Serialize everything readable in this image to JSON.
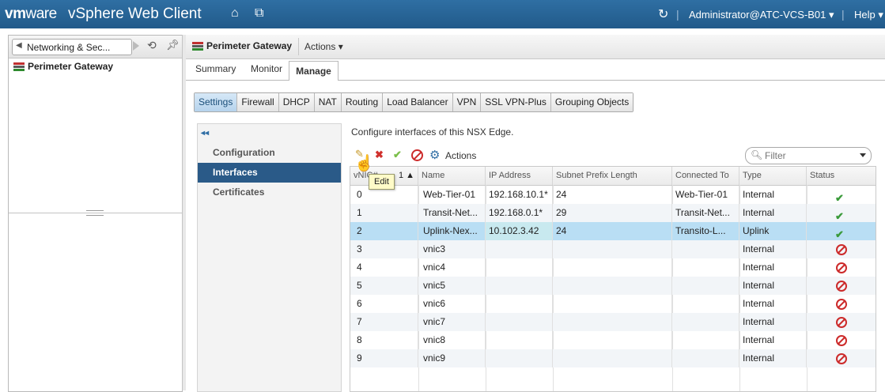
{
  "app": {
    "logo_vm": "vm",
    "logo_ware": "ware",
    "title": "vSphere Web Client",
    "user": "Administrator@ATC-VCS-B01",
    "help": "Help"
  },
  "left": {
    "nav_label": "Networking & Sec...",
    "tree_item": "Perimeter Gateway"
  },
  "main": {
    "title": "Perimeter Gateway",
    "actions": "Actions",
    "tabs": [
      "Summary",
      "Monitor",
      "Manage"
    ],
    "subtabs": [
      "Settings",
      "Firewall",
      "DHCP",
      "NAT",
      "Routing",
      "Load Balancer",
      "VPN",
      "SSL VPN-Plus",
      "Grouping Objects"
    ],
    "inner_nav": [
      "Configuration",
      "Interfaces",
      "Certificates"
    ],
    "description": "Configure interfaces of this NSX Edge.",
    "toolbar_actions": "Actions",
    "tooltip": "Edit",
    "filter_placeholder": "Filter"
  },
  "grid": {
    "columns": [
      "vNIC#",
      "Name",
      "IP Address",
      "Subnet Prefix Length",
      "Connected To",
      "Type",
      "Status"
    ],
    "sort_indicator": "1 ▲",
    "rows": [
      {
        "vnic": "0",
        "name": "Web-Tier-01",
        "ip": "192.168.10.1*",
        "prefix": "24",
        "connected": "Web-Tier-01",
        "type": "Internal",
        "status": "connected"
      },
      {
        "vnic": "1",
        "name": "Transit-Net...",
        "ip": "192.168.0.1*",
        "prefix": "29",
        "connected": "Transit-Net...",
        "type": "Internal",
        "status": "connected"
      },
      {
        "vnic": "2",
        "name": "Uplink-Nex...",
        "ip": "10.102.3.42",
        "prefix": "24",
        "connected": "Transito-L...",
        "type": "Uplink",
        "status": "connected"
      },
      {
        "vnic": "3",
        "name": "vnic3",
        "ip": "",
        "prefix": "",
        "connected": "",
        "type": "Internal",
        "status": "disconnected"
      },
      {
        "vnic": "4",
        "name": "vnic4",
        "ip": "",
        "prefix": "",
        "connected": "",
        "type": "Internal",
        "status": "disconnected"
      },
      {
        "vnic": "5",
        "name": "vnic5",
        "ip": "",
        "prefix": "",
        "connected": "",
        "type": "Internal",
        "status": "disconnected"
      },
      {
        "vnic": "6",
        "name": "vnic6",
        "ip": "",
        "prefix": "",
        "connected": "",
        "type": "Internal",
        "status": "disconnected"
      },
      {
        "vnic": "7",
        "name": "vnic7",
        "ip": "",
        "prefix": "",
        "connected": "",
        "type": "Internal",
        "status": "disconnected"
      },
      {
        "vnic": "8",
        "name": "vnic8",
        "ip": "",
        "prefix": "",
        "connected": "",
        "type": "Internal",
        "status": "disconnected"
      },
      {
        "vnic": "9",
        "name": "vnic9",
        "ip": "",
        "prefix": "",
        "connected": "",
        "type": "Internal",
        "status": "disconnected"
      }
    ]
  },
  "icons": {
    "status_ok": "green-check-icon",
    "status_disabled": "red-no-entry-icon"
  }
}
